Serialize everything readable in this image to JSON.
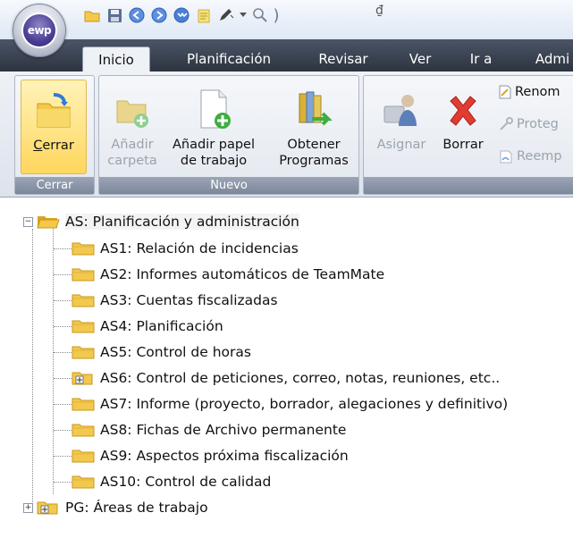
{
  "app": {
    "logo_text": "ewp"
  },
  "quick_access": {
    "items": [
      "open-folder-icon",
      "save-icon",
      "back-icon",
      "forward-icon",
      "refresh-icon",
      "notes-icon",
      "pen-icon",
      "search-icon"
    ],
    "customize_glyph": "₫"
  },
  "tabs": [
    {
      "label": "Inicio",
      "active": true
    },
    {
      "label": "Planificación",
      "active": false
    },
    {
      "label": "Revisar",
      "active": false
    },
    {
      "label": "Ver",
      "active": false
    },
    {
      "label": "Ir a",
      "active": false
    },
    {
      "label": "Admi",
      "active": false
    }
  ],
  "ribbon": {
    "groups": {
      "cerrar": {
        "label": "Cerrar",
        "button": {
          "label": "Cerrar",
          "underline": "C"
        }
      },
      "nuevo": {
        "label": "Nuevo",
        "buttons": [
          {
            "line1": "Añadir",
            "line2": "carpeta",
            "enabled": false
          },
          {
            "line1": "Añadir papel",
            "line2": "de trabajo",
            "enabled": true
          },
          {
            "line1": "Obtener",
            "line2": "Programas",
            "enabled": true
          }
        ]
      },
      "edit": {
        "buttons": [
          {
            "label": "Asignar",
            "enabled": false
          },
          {
            "label": "Borrar",
            "enabled": true
          }
        ],
        "small_buttons": [
          {
            "label": "Renom",
            "enabled": true
          },
          {
            "label": "Proteg",
            "enabled": false
          },
          {
            "label": "Reemp",
            "enabled": false
          }
        ]
      }
    }
  },
  "tree": {
    "root": {
      "label": "AS: Planificación y administración",
      "expanded": true
    },
    "children": [
      {
        "label": "AS1: Relación de incidencias",
        "has_children": false
      },
      {
        "label": "AS2: Informes automáticos de TeamMate",
        "has_children": false
      },
      {
        "label": "AS3: Cuentas fiscalizadas",
        "has_children": false
      },
      {
        "label": "AS4: Planificación",
        "has_children": false
      },
      {
        "label": "AS5: Control de horas",
        "has_children": false
      },
      {
        "label": "AS6: Control de peticiones, correo, notas, reuniones, etc..",
        "has_children": true
      },
      {
        "label": "AS7: Informe (proyecto, borrador, alegaciones y definitivo)",
        "has_children": false
      },
      {
        "label": "AS8: Fichas de Archivo permanente",
        "has_children": false
      },
      {
        "label": "AS9: Aspectos próxima fiscalización",
        "has_children": false
      },
      {
        "label": "AS10: Control de calidad",
        "has_children": false
      }
    ],
    "second_root": {
      "label": "PG: Áreas de trabajo",
      "expanded": false
    }
  },
  "colors": {
    "folder": "#f2c94c",
    "folder_dark": "#d9a520",
    "accent_green": "#3fae3f",
    "delete_red": "#e03c31"
  }
}
